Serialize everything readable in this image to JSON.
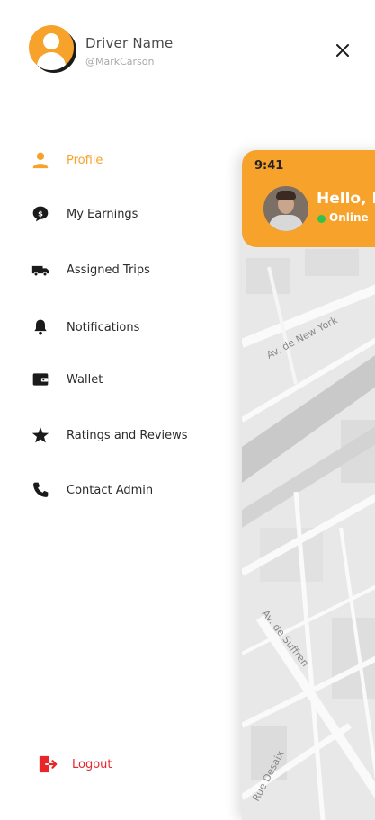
{
  "drawer": {
    "driver_name": "Driver Name",
    "driver_handle": "@MarkCarson",
    "close_icon": "close-icon"
  },
  "menu": {
    "items": [
      {
        "label": "Profile",
        "icon": "person-icon",
        "active": true
      },
      {
        "label": "My Earnings",
        "icon": "dollar-icon",
        "active": false
      },
      {
        "label": "Assigned Trips",
        "icon": "truck-icon",
        "active": false
      },
      {
        "label": "Notifications",
        "icon": "bell-icon",
        "active": false
      },
      {
        "label": "Wallet",
        "icon": "wallet-icon",
        "active": false
      },
      {
        "label": "Ratings and Reviews",
        "icon": "star-icon",
        "active": false
      },
      {
        "label": "Contact Admin",
        "icon": "phone-icon",
        "active": false
      }
    ],
    "logout_label": "Logout"
  },
  "preview": {
    "time": "9:41",
    "greeting": "Hello, D",
    "status": "Online",
    "map_labels": [
      "Av. de New York",
      "Av. de Suffren",
      "Rue Desaix"
    ]
  },
  "colors": {
    "accent": "#f7a22b",
    "logout": "#e8262a",
    "online": "#31c24b"
  }
}
